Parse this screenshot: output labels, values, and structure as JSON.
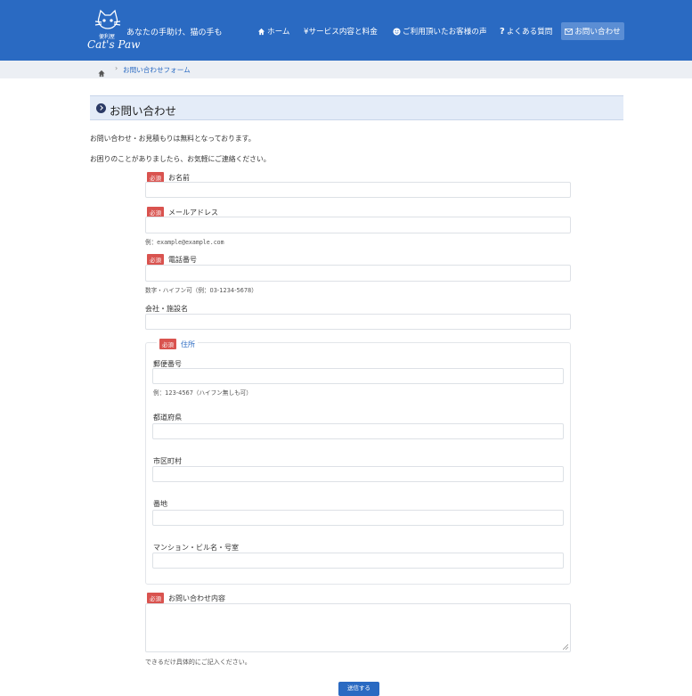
{
  "header": {
    "logo_small": "便利屋",
    "logo_main": "Cat's Paw",
    "tagline": "あなたの手助け、猫の手も",
    "nav": {
      "home": "ホーム",
      "service": "¥サービス内容と料金",
      "voice": "ご利用頂いたお客様の声",
      "faq": "よくある質問",
      "contact": "お問い合わせ"
    }
  },
  "breadcrumb": {
    "current": "お問い合わせフォーム"
  },
  "page": {
    "title": "お問い合わせ",
    "intro1": "お問い合わせ・お見積もりは無料となっております。",
    "intro2": "お困りのことがありましたら、お気軽にご連絡ください。"
  },
  "form": {
    "required_badge": "必須",
    "name_label": "お名前",
    "email_label": "メールアドレス",
    "email_help": "例：example@example.com",
    "phone_label": "電話番号",
    "phone_help": "数字・ハイフン可（例：03-1234-5678）",
    "company_label": "会社・施設名",
    "address_legend": "住所",
    "postal_label": "郵便番号",
    "postal_help": "例：123-4567（ハイフン無しも可）",
    "prefecture_label": "都道府県",
    "city_label": "市区町村",
    "street_label": "番地",
    "building_label": "マンション・ビル名・号室",
    "message_label": "お問い合わせ内容",
    "message_help": "できるだけ具体的にご記入ください。",
    "submit_label": "送信する"
  },
  "colors": {
    "header_bg": "#2a6ac2",
    "required_badge": "#d9534f",
    "title_bg": "#e4ecf8"
  }
}
